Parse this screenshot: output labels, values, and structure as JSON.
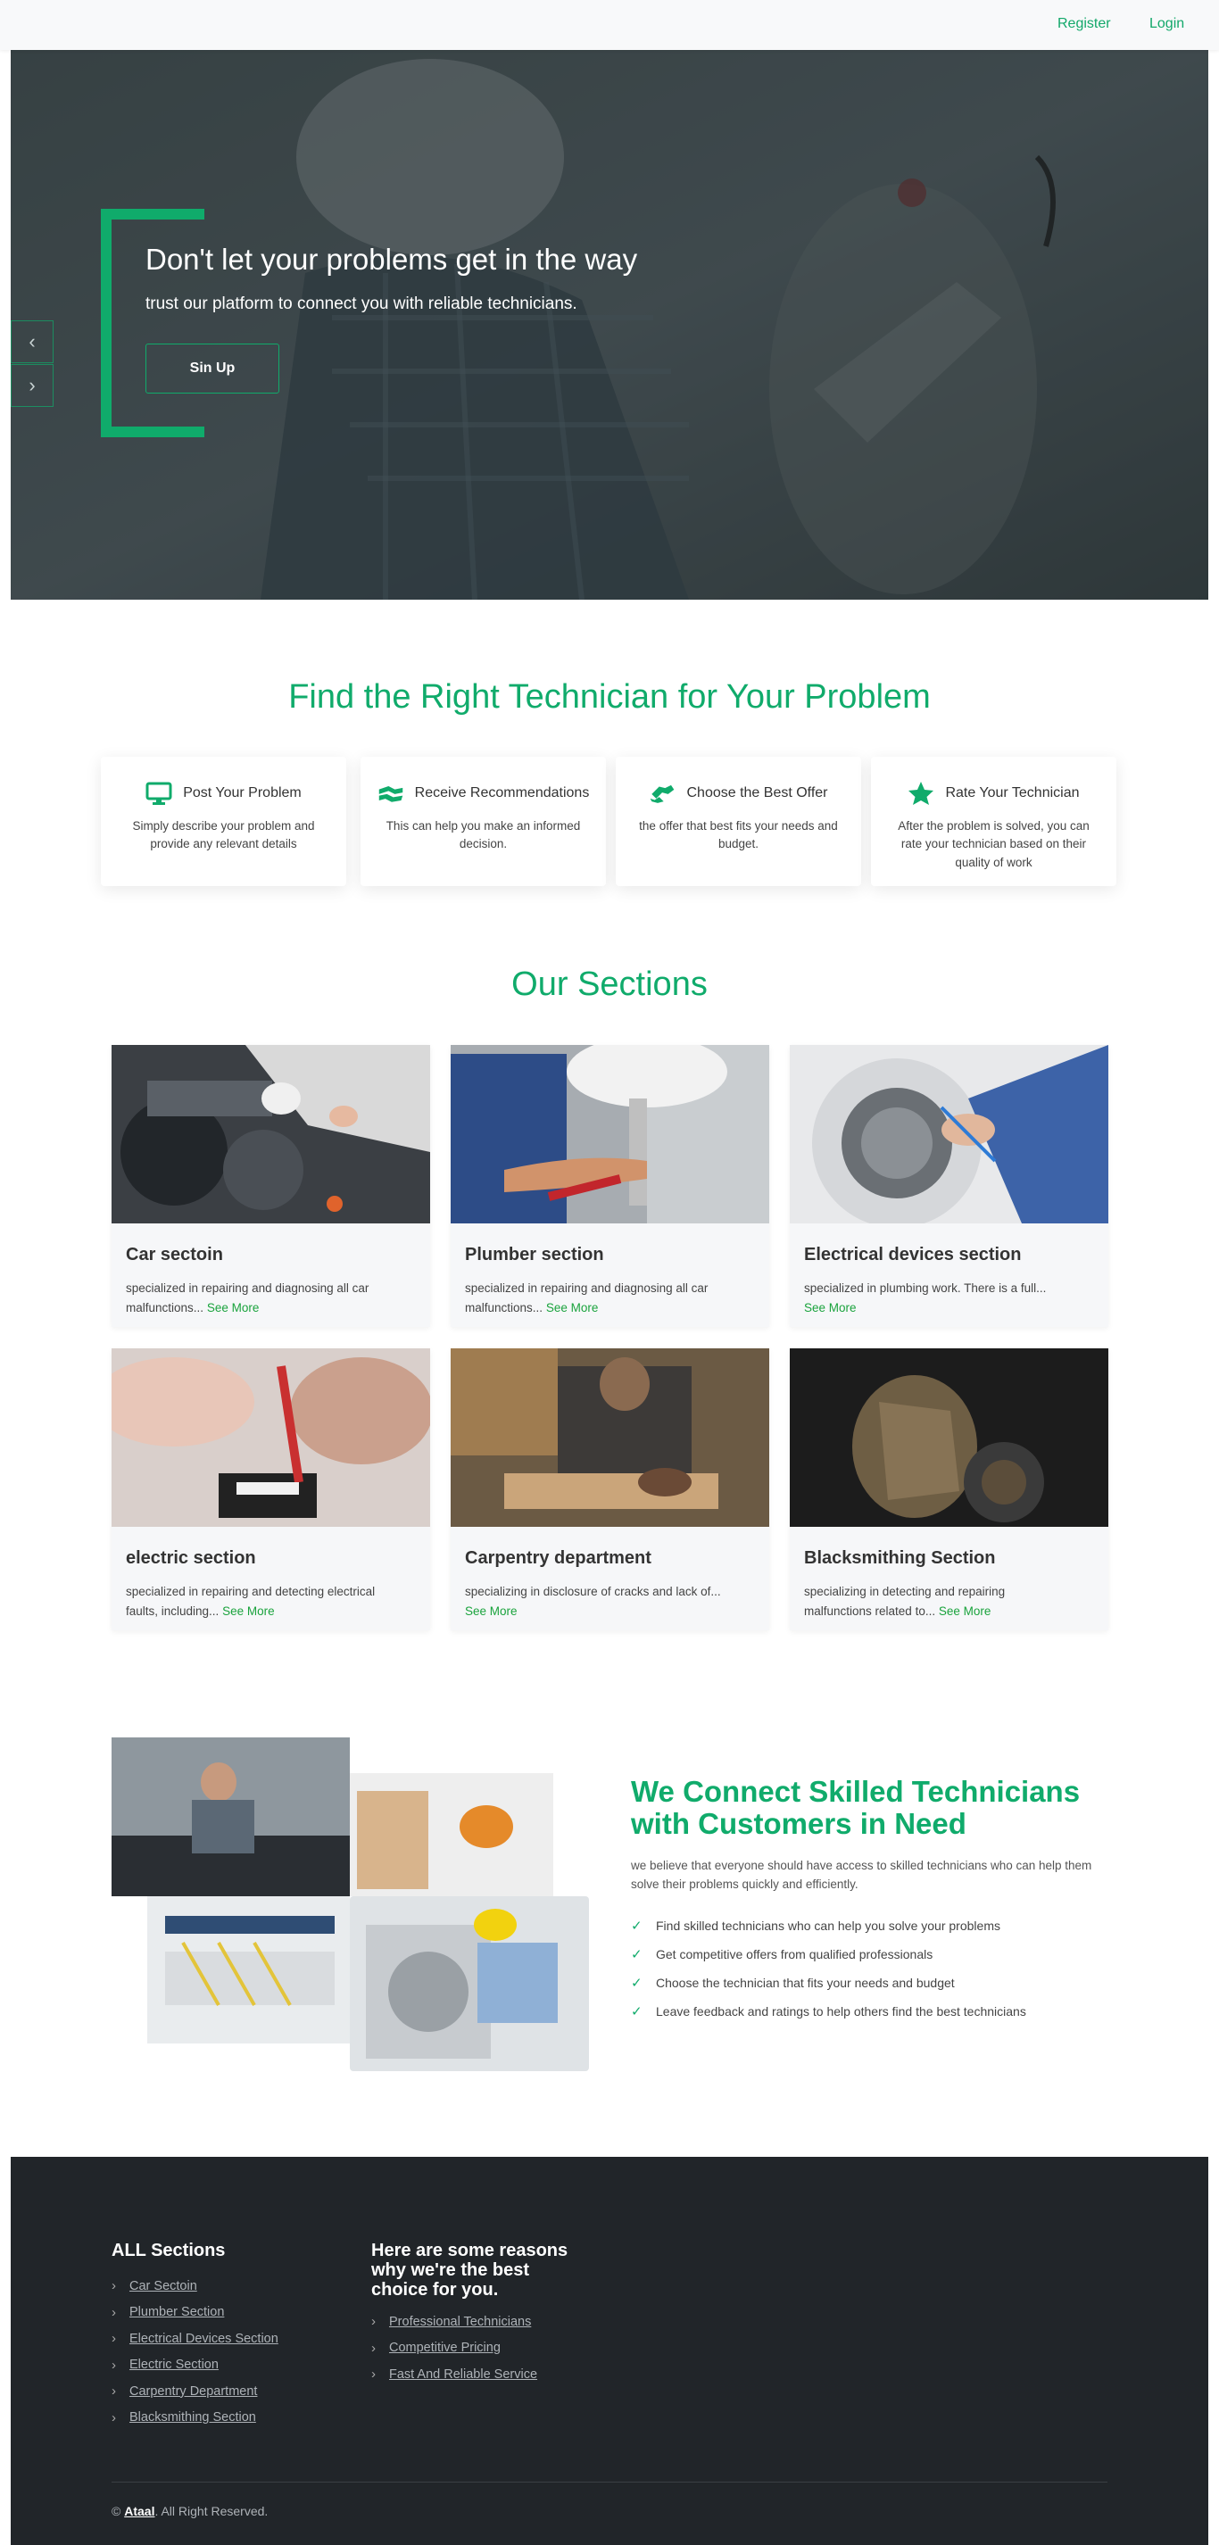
{
  "nav": {
    "register": "Register",
    "login": "Login"
  },
  "hero": {
    "title": "Don't let your problems get in the way",
    "subtitle": "trust our platform to connect you with reliable technicians.",
    "button": "Sin Up"
  },
  "steps": {
    "title": "Find the Right Technician for Your Problem",
    "items": [
      {
        "icon": "monitor-icon",
        "title": "Post Your Problem",
        "text": "Simply describe your problem and provide any relevant details"
      },
      {
        "icon": "handshake-icon",
        "title": "Receive Recommendations",
        "text": "This can help you make an informed decision."
      },
      {
        "icon": "exchange-icon",
        "title": "Choose the Best Offer",
        "text": "the offer that best fits your needs and budget."
      },
      {
        "icon": "star-icon",
        "title": "Rate Your Technician",
        "text": "After the problem is solved, you can rate your technician based on their quality of work"
      }
    ]
  },
  "sections": {
    "title": "Our Sections",
    "see_more": "See More",
    "items": [
      {
        "name": "Car sectoin",
        "desc": "specialized in repairing and diagnosing all car malfunctions..."
      },
      {
        "name": "Plumber section",
        "desc": "specialized in repairing and diagnosing all car malfunctions..."
      },
      {
        "name": "Electrical devices section",
        "desc": "specialized in plumbing work. There is a full..."
      },
      {
        "name": "electric section",
        "desc": "specialized in repairing and detecting electrical faults, including..."
      },
      {
        "name": "Carpentry department",
        "desc": "specializing in disclosure of cracks and lack of..."
      },
      {
        "name": "Blacksmithing Section",
        "desc": "specializing in detecting and repairing malfunctions related to..."
      }
    ]
  },
  "connect": {
    "title": "We Connect Skilled Technicians with Customers in Need",
    "desc": "we believe that everyone should have access to skilled technicians who can help them solve their problems quickly and efficiently.",
    "points": [
      "Find skilled technicians who can help you solve your problems",
      "Get competitive offers from qualified professionals",
      "Choose the technician that fits your needs and budget",
      "Leave feedback and ratings to help others find the best technicians"
    ]
  },
  "footer": {
    "sections_title": "ALL Sections",
    "sections": [
      "Car Sectoin",
      "Plumber Section",
      "Electrical Devices Section",
      "Electric Section",
      "Carpentry Department",
      "Blacksmithing Section"
    ],
    "reasons_title": "Here are some reasons why we're the best choice for you.",
    "reasons": [
      "Professional Technicians",
      "Competitive Pricing",
      "Fast And Reliable Service"
    ],
    "brand": "Ataal",
    "rights": ". All Right Reserved."
  },
  "colors": {
    "accent": "#10ab6b",
    "see_more": "#1aa33d",
    "footer_bg": "#212529"
  }
}
